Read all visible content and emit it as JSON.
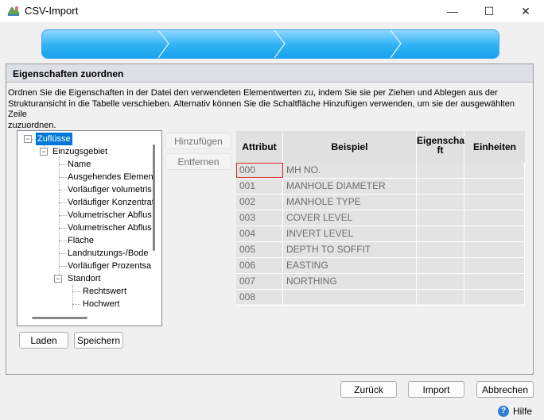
{
  "window": {
    "title": "CSV-Import",
    "minimize_glyph": "—",
    "maximize_glyph": "☐",
    "close_glyph": "✕"
  },
  "section": {
    "title": "Eigenschaften zuordnen",
    "description_line1": "Ordnen Sie die Eigenschaften in der Datei den verwendeten Elementwerten zu, indem Sie sie per Ziehen und Ablegen aus der",
    "description_line2": "Strukturansicht in die Tabelle verschieben. Alternativ können Sie die Schaltfläche Hinzufügen verwenden, um sie der ausgewählten Zeile",
    "description_line3": "zuzuordnen."
  },
  "tree": {
    "root": "Zuflüsse",
    "group": "Einzugsgebiet",
    "items": [
      "Name",
      "Ausgehendes Elemen",
      "Vorläufiger volumetris",
      "Vorläufiger Konzentrat",
      "Volumetrischer Abflus",
      "Volumetrischer Abflus",
      "Fläche",
      "Landnutzungs-/Bode",
      "Vorläufiger Prozentsa"
    ],
    "subgroup": "Standort",
    "subitems": [
      "Rechtswert",
      "Hochwert"
    ]
  },
  "actions": {
    "add_label": "Hinzufügen",
    "remove_label": "Entfernen",
    "load_label": "Laden",
    "save_label": "Speichern"
  },
  "table": {
    "headers": {
      "attribute": "Attribut",
      "example": "Beispiel",
      "property_line1": "Eigenscha",
      "property_line2": "ft",
      "units": "Einheiten"
    },
    "rows": [
      {
        "attribute": "000",
        "example": "MH NO."
      },
      {
        "attribute": "001",
        "example": "MANHOLE DIAMETER"
      },
      {
        "attribute": "002",
        "example": "MANHOLE TYPE"
      },
      {
        "attribute": "003",
        "example": "COVER LEVEL"
      },
      {
        "attribute": "004",
        "example": "INVERT LEVEL"
      },
      {
        "attribute": "005",
        "example": "DEPTH TO SOFFIT"
      },
      {
        "attribute": "006",
        "example": "EASTING"
      },
      {
        "attribute": "007",
        "example": "NORTHING"
      },
      {
        "attribute": "008",
        "example": ""
      }
    ]
  },
  "footer": {
    "back_label": "Zurück",
    "import_label": "Import",
    "cancel_label": "Abbrechen",
    "help_label": "Hilfe"
  },
  "colors": {
    "wizard_accent": "#2fb2f5",
    "selection": "#0078d7",
    "selected_cell_border": "#d62a2a"
  }
}
